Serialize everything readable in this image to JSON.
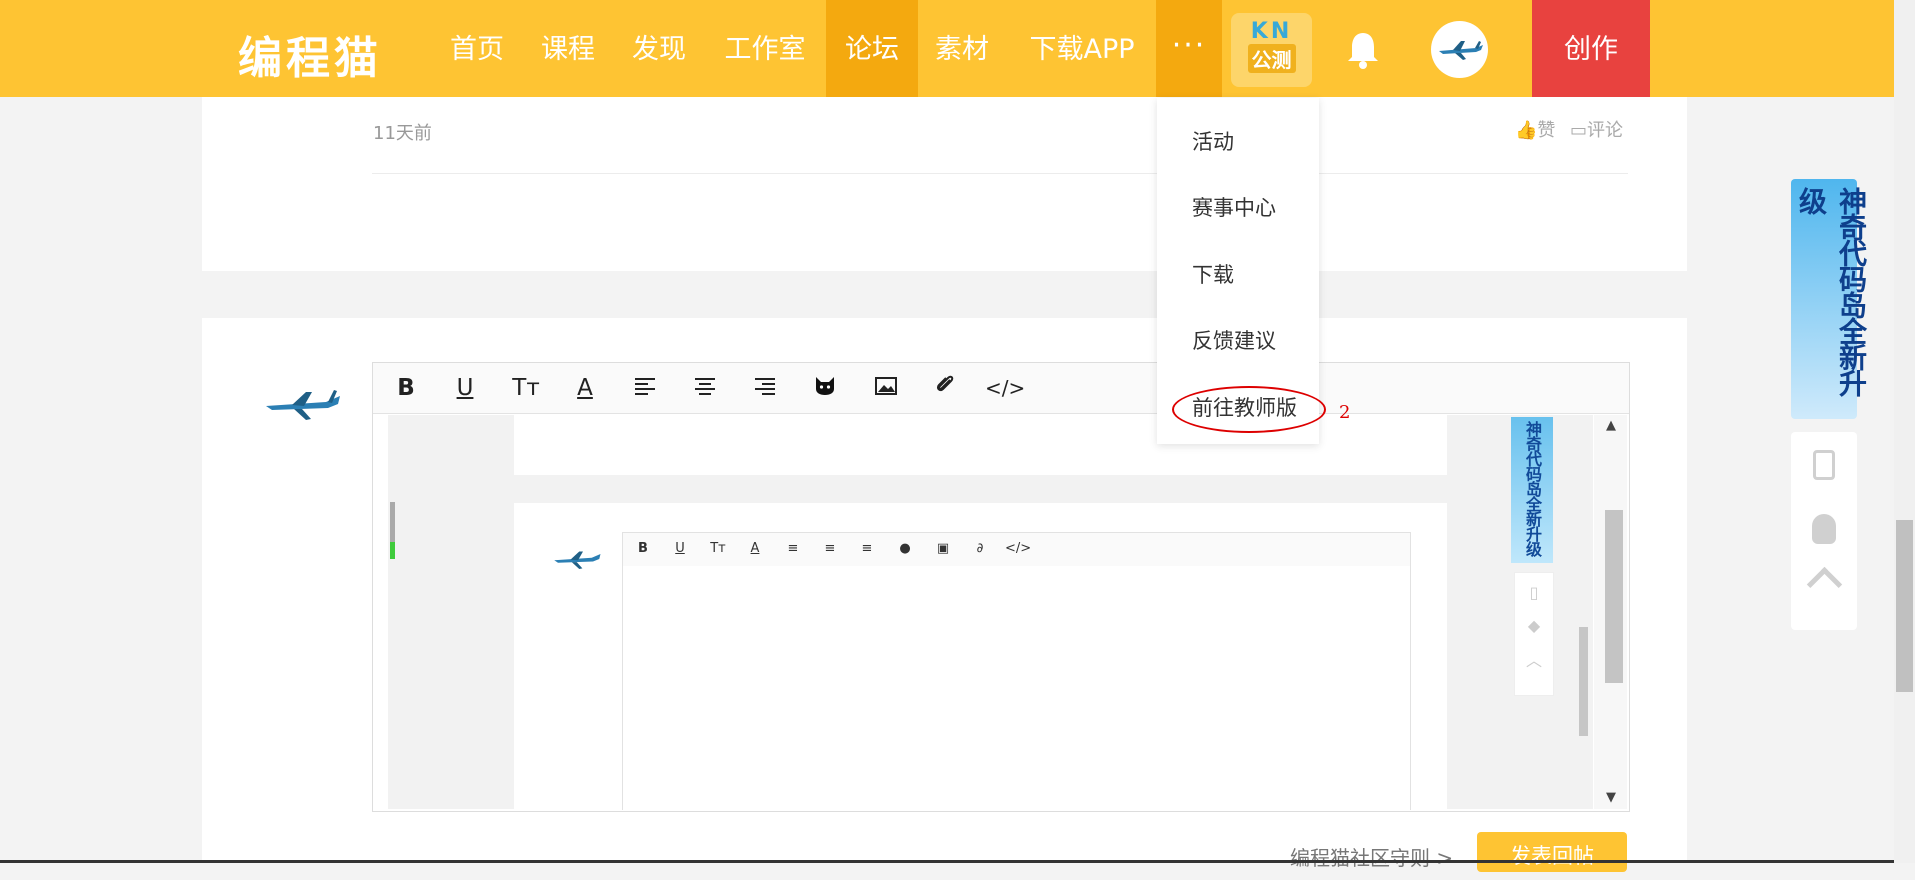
{
  "header": {
    "logo": "编程猫",
    "nav": [
      "首页",
      "课程",
      "发现",
      "工作室",
      "论坛",
      "素材",
      "下载APP"
    ],
    "active_nav": "论坛",
    "more_label": "···",
    "kn_top": "KN",
    "kn_badge": "公测",
    "create_label": "创作",
    "colors": {
      "bar": "#fec433",
      "active": "#f4a90f",
      "create": "#e8423f"
    }
  },
  "post": {
    "time": "11天前",
    "like_label": "赞",
    "comment_label": "评论"
  },
  "dropdown": {
    "items": [
      "活动",
      "赛事中心",
      "下载",
      "反馈建议",
      "前往教师版"
    ],
    "annotation": "2"
  },
  "editor": {
    "toolbar": [
      "B",
      "U",
      "Tт",
      "A",
      "≡",
      "≡",
      "≡",
      "cat",
      "image",
      "clip",
      "</>"
    ]
  },
  "footer": {
    "rules_link": "编程猫社区守则 >",
    "submit_label": "发表回帖"
  },
  "side": {
    "banner_text": "神奇代码岛全新升级"
  }
}
